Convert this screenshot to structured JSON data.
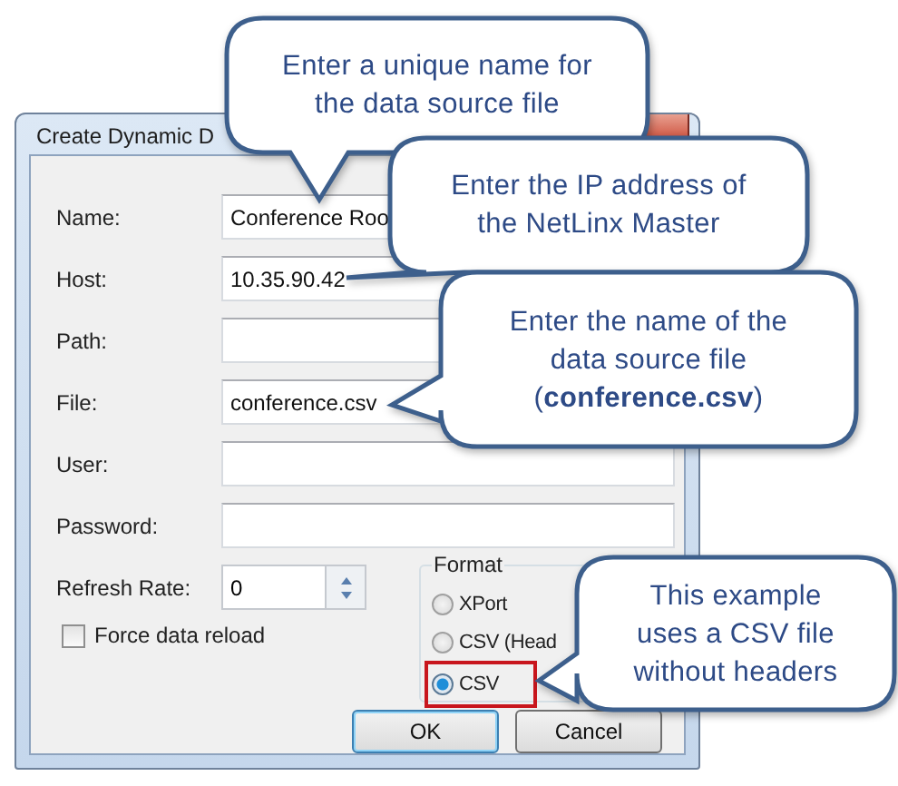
{
  "window": {
    "title": "Create Dynamic D"
  },
  "fields": [
    {
      "label": "Name:",
      "value": "Conference Roo"
    },
    {
      "label": "Host:",
      "value": "10.35.90.42"
    },
    {
      "label": "Path:"
    },
    {
      "label": "File:",
      "value": "conference.csv"
    },
    {
      "label": "User:"
    },
    {
      "label": "Password:"
    }
  ],
  "refresh_rate": {
    "label": "Refresh Rate:",
    "value": "0"
  },
  "force_reload": {
    "label": "Force data reload",
    "checked": false
  },
  "format": {
    "label": "Format",
    "options": [
      {
        "label": "XPort",
        "selected": false,
        "highlighted": false
      },
      {
        "label": "CSV (Head",
        "selected": false,
        "highlighted": false
      },
      {
        "label": "CSV",
        "selected": true,
        "highlighted": true
      }
    ]
  },
  "buttons": [
    {
      "label": "OK",
      "default": true
    },
    {
      "label": "Cancel",
      "default": false
    }
  ],
  "callouts": [
    {
      "lines": [
        "Enter a unique name for",
        "the data source file"
      ]
    },
    {
      "lines": [
        "Enter the IP address of",
        "the NetLinx Master"
      ]
    },
    {
      "lines": [
        "Enter the name of the",
        "data source file",
        "(**conference.csv**)"
      ]
    },
    {
      "lines": [
        "This example",
        "uses a CSV file",
        "without headers"
      ]
    }
  ]
}
